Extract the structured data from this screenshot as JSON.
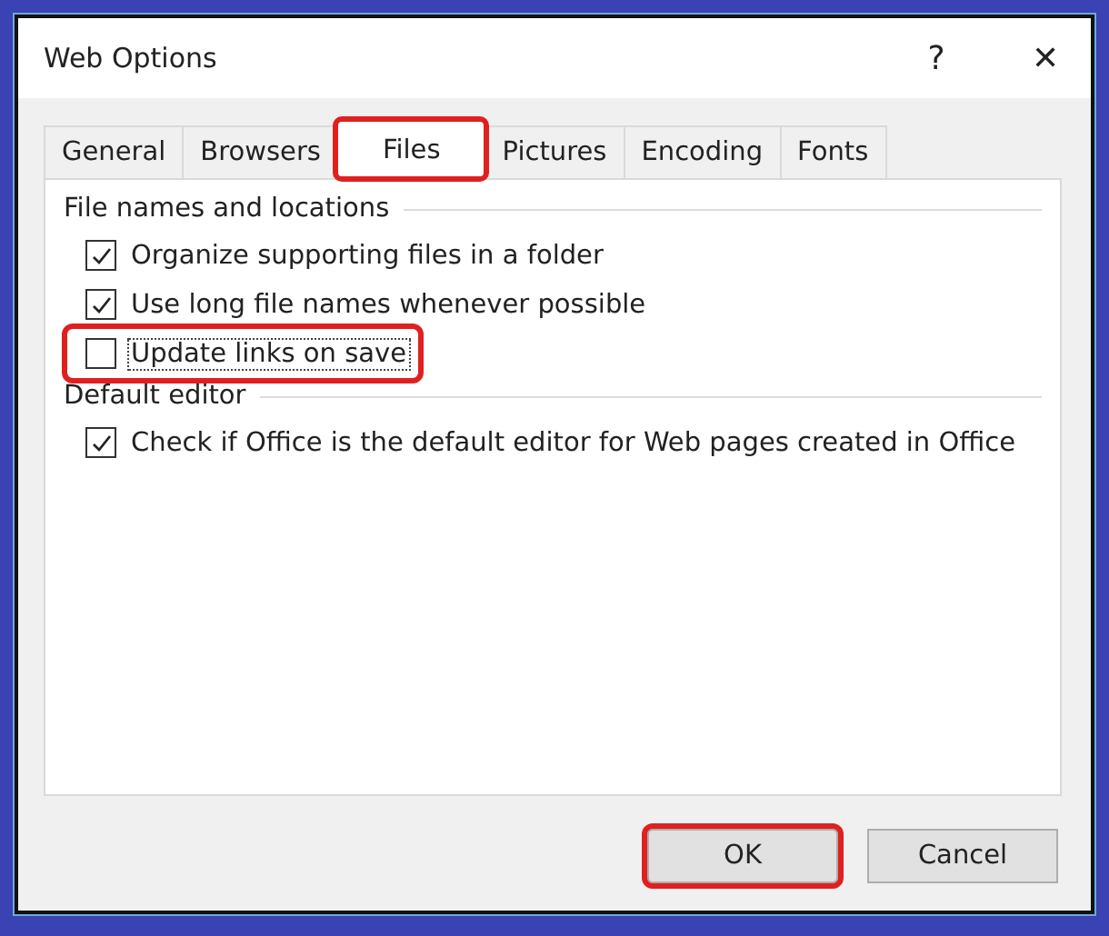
{
  "window": {
    "title": "Web Options",
    "help": "?",
    "close": "✕"
  },
  "tabs": [
    {
      "label": "General",
      "selected": false,
      "highlighted": false
    },
    {
      "label": "Browsers",
      "selected": false,
      "highlighted": false
    },
    {
      "label": "Files",
      "selected": true,
      "highlighted": true
    },
    {
      "label": "Pictures",
      "selected": false,
      "highlighted": false
    },
    {
      "label": "Encoding",
      "selected": false,
      "highlighted": false
    },
    {
      "label": "Fonts",
      "selected": false,
      "highlighted": false
    }
  ],
  "groups": [
    {
      "title": "File names and locations",
      "options": [
        {
          "label": "Organize supporting files in a folder",
          "checked": true,
          "focused": false,
          "highlighted": false
        },
        {
          "label": "Use long file names whenever possible",
          "checked": true,
          "focused": false,
          "highlighted": false
        },
        {
          "label": "Update links on save",
          "checked": false,
          "focused": true,
          "highlighted": true
        }
      ]
    },
    {
      "title": "Default editor",
      "options": [
        {
          "label": "Check if Office is the default editor for Web pages created in Office",
          "checked": true,
          "focused": false,
          "highlighted": false
        }
      ]
    }
  ],
  "buttons": [
    {
      "label": "OK",
      "highlighted": true
    },
    {
      "label": "Cancel",
      "highlighted": false
    }
  ]
}
